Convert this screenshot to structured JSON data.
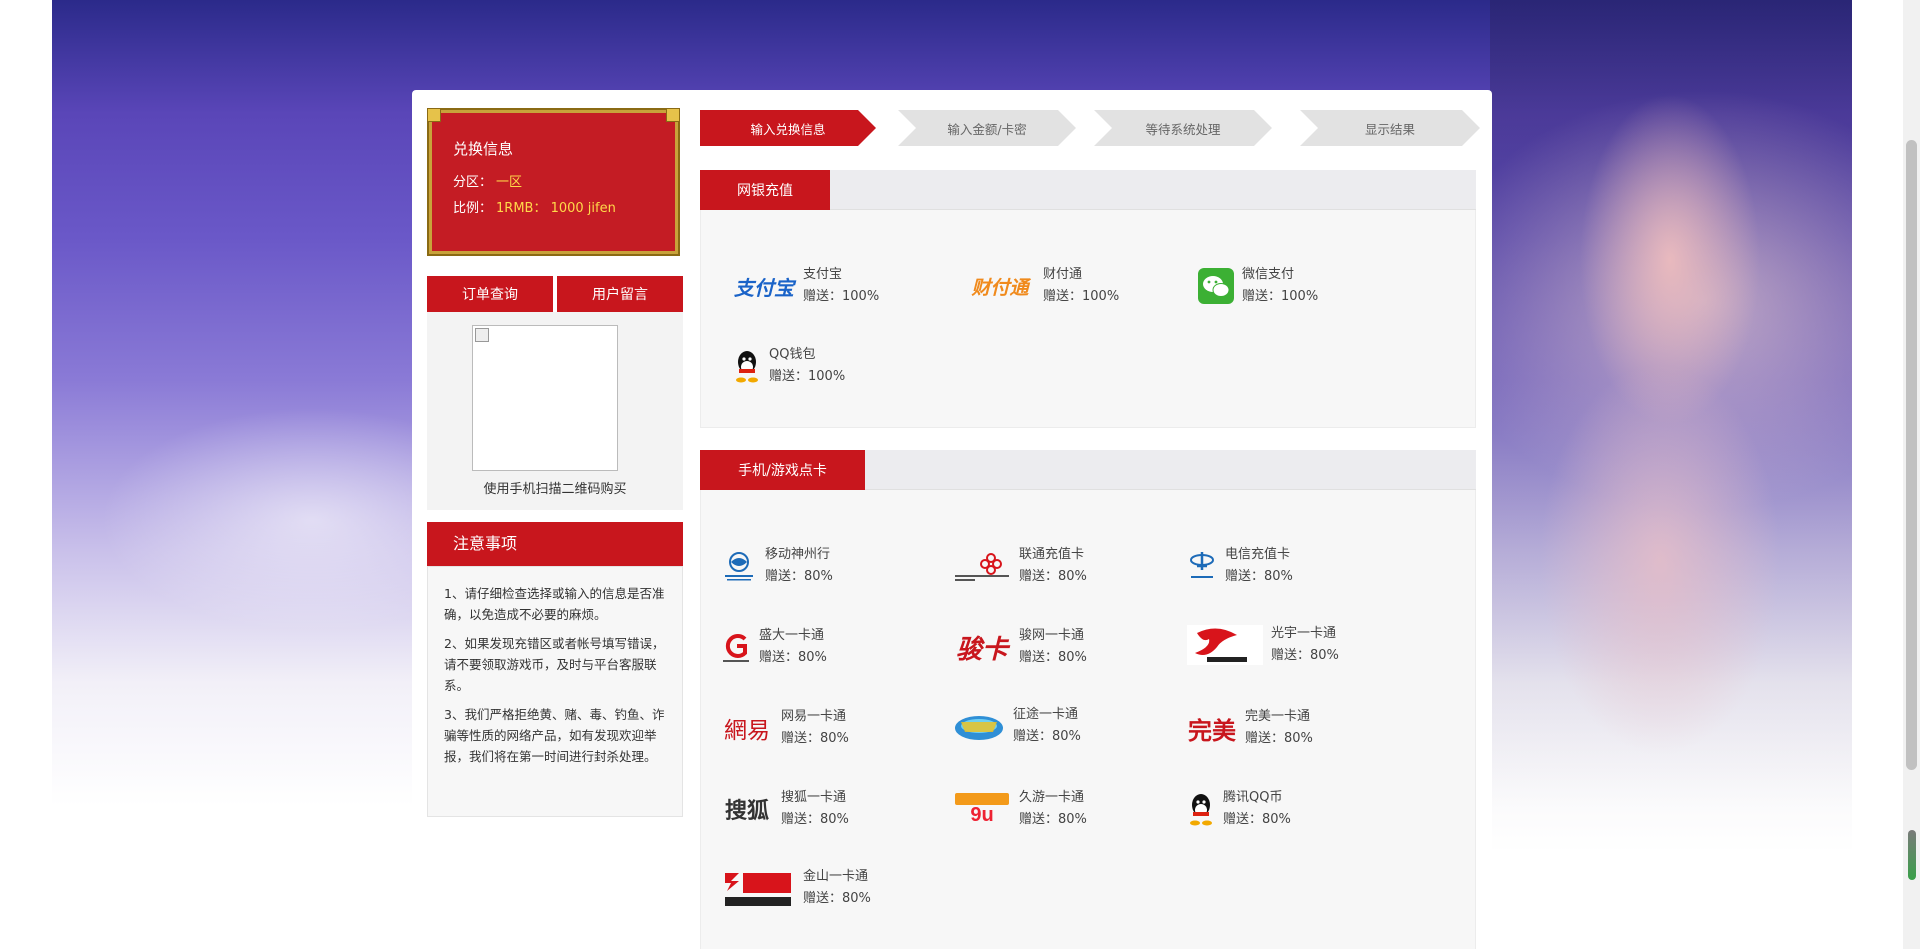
{
  "info_card": {
    "title": "兑换信息",
    "zone_label": "分区：",
    "zone_value": "一区",
    "ratio_label": "比例：",
    "ratio_value": "1RMB： 1000 jifen"
  },
  "left_buttons": {
    "order_query": "订单查询",
    "user_message": "用户留言"
  },
  "qr": {
    "caption": "使用手机扫描二维码购买"
  },
  "notice": {
    "title": "注意事项",
    "items": [
      "1、请仔细检查选择或输入的信息是否准确，以免造成不必要的麻烦。",
      "2、如果发现充错区或者帐号填写错误，请不要领取游戏币，及时与平台客服联系。",
      "3、我们严格拒绝黄、赌、毒、钓鱼、诈骗等性质的网络产品，如有发现欢迎举报，我们将在第一时间进行封杀处理。"
    ]
  },
  "steps": [
    "输入兑换信息",
    "输入金额/卡密",
    "等待系统处理",
    "显示结果"
  ],
  "bank": {
    "tab": "网银充值",
    "items": [
      {
        "name": "支付宝",
        "bonus": "赠送：100%",
        "icon": "alipay-icon",
        "logo_text": "支付宝"
      },
      {
        "name": "财付通",
        "bonus": "赠送：100%",
        "icon": "tenpay-icon",
        "logo_text": "财付通"
      },
      {
        "name": "微信支付",
        "bonus": "赠送：100%",
        "icon": "wechat-pay-icon"
      },
      {
        "name": "QQ钱包",
        "bonus": "赠送：100%",
        "icon": "qq-wallet-icon"
      }
    ]
  },
  "cards": {
    "tab": "手机/游戏点卡",
    "items": [
      {
        "name": "移动神州行",
        "bonus": "赠送：80%",
        "icon": "china-mobile-icon"
      },
      {
        "name": "联通充值卡",
        "bonus": "赠送：80%",
        "icon": "china-unicom-icon"
      },
      {
        "name": "电信充值卡",
        "bonus": "赠送：80%",
        "icon": "china-telecom-icon"
      },
      {
        "name": "盛大一卡通",
        "bonus": "赠送：80%",
        "icon": "shanda-icon"
      },
      {
        "name": "骏网一卡通",
        "bonus": "赠送：80%",
        "icon": "junwang-icon",
        "logo_text": "骏卡"
      },
      {
        "name": "光宇一卡通",
        "bonus": "赠送：80%",
        "icon": "guangyu-icon"
      },
      {
        "name": "网易一卡通",
        "bonus": "赠送：80%",
        "icon": "netease-icon",
        "logo_text": "網易"
      },
      {
        "name": "征途一卡通",
        "bonus": "赠送：80%",
        "icon": "zhengtu-icon"
      },
      {
        "name": "完美一卡通",
        "bonus": "赠送：80%",
        "icon": "wanmei-icon",
        "logo_text": "完美"
      },
      {
        "name": "搜狐一卡通",
        "bonus": "赠送：80%",
        "icon": "sohu-icon",
        "logo_text": "搜狐"
      },
      {
        "name": "久游一卡通",
        "bonus": "赠送：80%",
        "icon": "jiuyou-icon"
      },
      {
        "name": "腾讯QQ币",
        "bonus": "赠送：80%",
        "icon": "tencent-qq-icon"
      },
      {
        "name": "金山一卡通",
        "bonus": "赠送：80%",
        "icon": "kingsoft-icon"
      }
    ]
  },
  "colors": {
    "brand_red": "#c8161d",
    "gold": "#ffd94a"
  }
}
